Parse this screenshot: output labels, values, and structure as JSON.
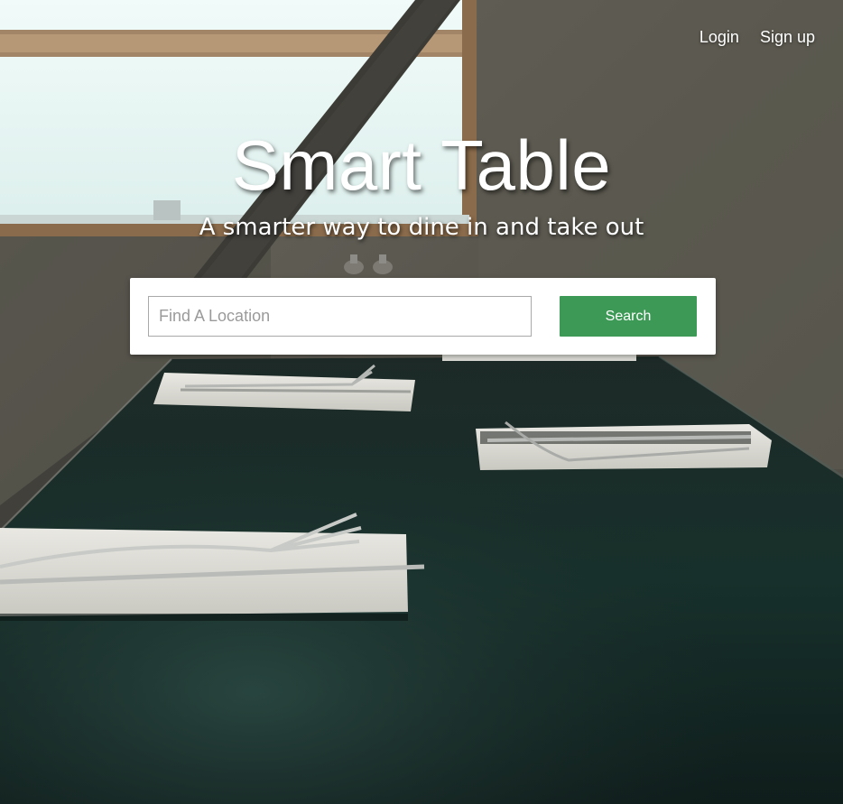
{
  "nav": {
    "login_label": "Login",
    "signup_label": "Sign up"
  },
  "hero": {
    "title": "Smart Table",
    "tagline": "A smarter way to dine in and take out"
  },
  "search": {
    "value": "",
    "placeholder": "Find A Location",
    "button_label": "Search"
  },
  "colors": {
    "accent": "#3d9a56",
    "panel": "#ffffff",
    "text_on_image": "#ffffff"
  }
}
